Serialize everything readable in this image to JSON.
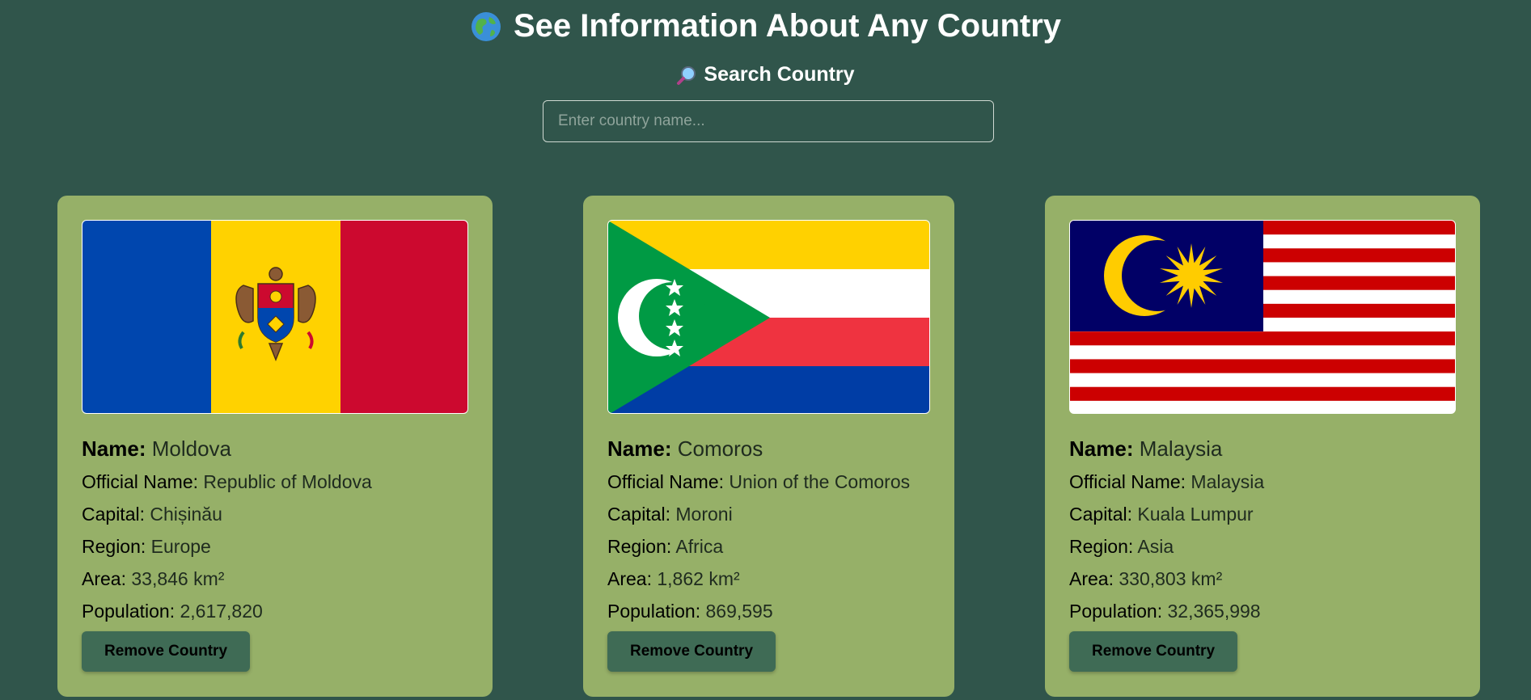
{
  "header": {
    "title_icon": "globe-icon",
    "title": "See Information About Any Country"
  },
  "search": {
    "label_icon": "magnifier-icon",
    "label": "Search Country",
    "placeholder": "Enter country name...",
    "value": ""
  },
  "labels": {
    "name": "Name:",
    "official_name": "Official Name:",
    "capital": "Capital:",
    "region": "Region:",
    "area": "Area:",
    "population": "Population:"
  },
  "cards": [
    {
      "name": "Moldova",
      "official_name": "Republic of Moldova",
      "capital": "Chișinău",
      "region": "Europe",
      "area": "33,846 km²",
      "population": "2,617,820",
      "remove_label": "Remove Country",
      "flag_icon": "moldova-flag"
    },
    {
      "name": "Comoros",
      "official_name": "Union of the Comoros",
      "capital": "Moroni",
      "region": "Africa",
      "area": "1,862 km²",
      "population": "869,595",
      "remove_label": "Remove Country",
      "flag_icon": "comoros-flag"
    },
    {
      "name": "Malaysia",
      "official_name": "Malaysia",
      "capital": "Kuala Lumpur",
      "region": "Asia",
      "area": "330,803 km²",
      "population": "32,365,998",
      "remove_label": "Remove Country",
      "flag_icon": "malaysia-flag"
    }
  ],
  "colors": {
    "background": "#30554b",
    "card": "#96b068",
    "button": "#3f6b55"
  }
}
